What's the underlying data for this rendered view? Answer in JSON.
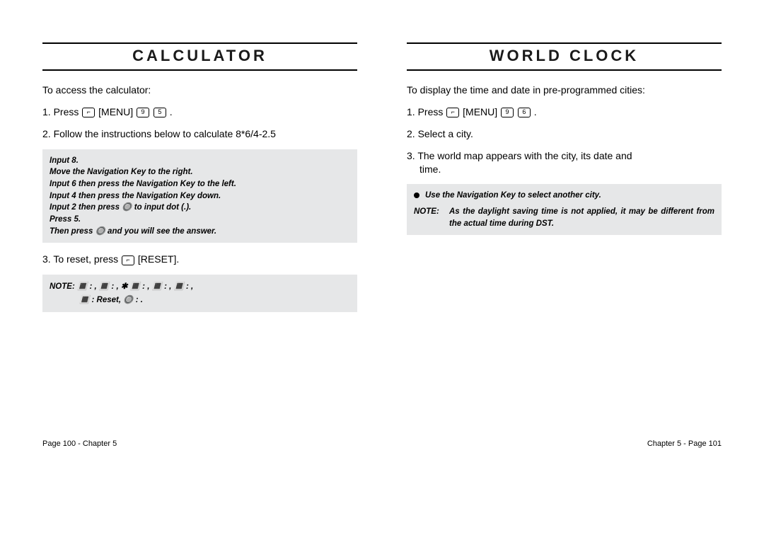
{
  "left": {
    "title": "CALCULATOR",
    "intro": "To access the calculator:",
    "step1_prefix": "1. Press ",
    "step1_menu": " [MENU] ",
    "step1_suffix": " .",
    "step2": "2. Follow the instructions below to calculate 8*6/4-2.5",
    "notebox_lines": [
      "Input 8.",
      "Move the Navigation Key to the right.",
      "Input 6 then press the Navigation Key to the left.",
      "Input 4 then press the Navigation Key down.",
      "Input 2 then press  🔘  to input dot (.).",
      "Press 5.",
      "Then press 🔘 and you will see the answer."
    ],
    "step3_prefix": "3. To reset, press ",
    "step3_reset": " [RESET].",
    "note_symbols_label": "NOTE:",
    "note_symbols_body": " 🔳 :   ,     🔳  :    , ✱ 🔳  :    ,     🔳  :    ,    🔳  :    ,",
    "note_symbols_line2": "🔳  : Reset,    🔘  :   .",
    "footer": "Page 100 - Chapter 5"
  },
  "right": {
    "title": "WORLD CLOCK",
    "intro": "To display the time and date in pre-programmed cities:",
    "step1_prefix": "1. Press ",
    "step1_menu": " [MENU] ",
    "step1_suffix": " .",
    "step2": "2. Select a city.",
    "step3": "3. The world map appears with the city, its date and",
    "step3b": "time.",
    "bullet": "Use the Navigation Key to select another city.",
    "note_label": "NOTE:",
    "note_text": "As the daylight saving time is not applied, it may be different from the actual time during DST.",
    "footer": "Chapter 5 - Page 101"
  }
}
